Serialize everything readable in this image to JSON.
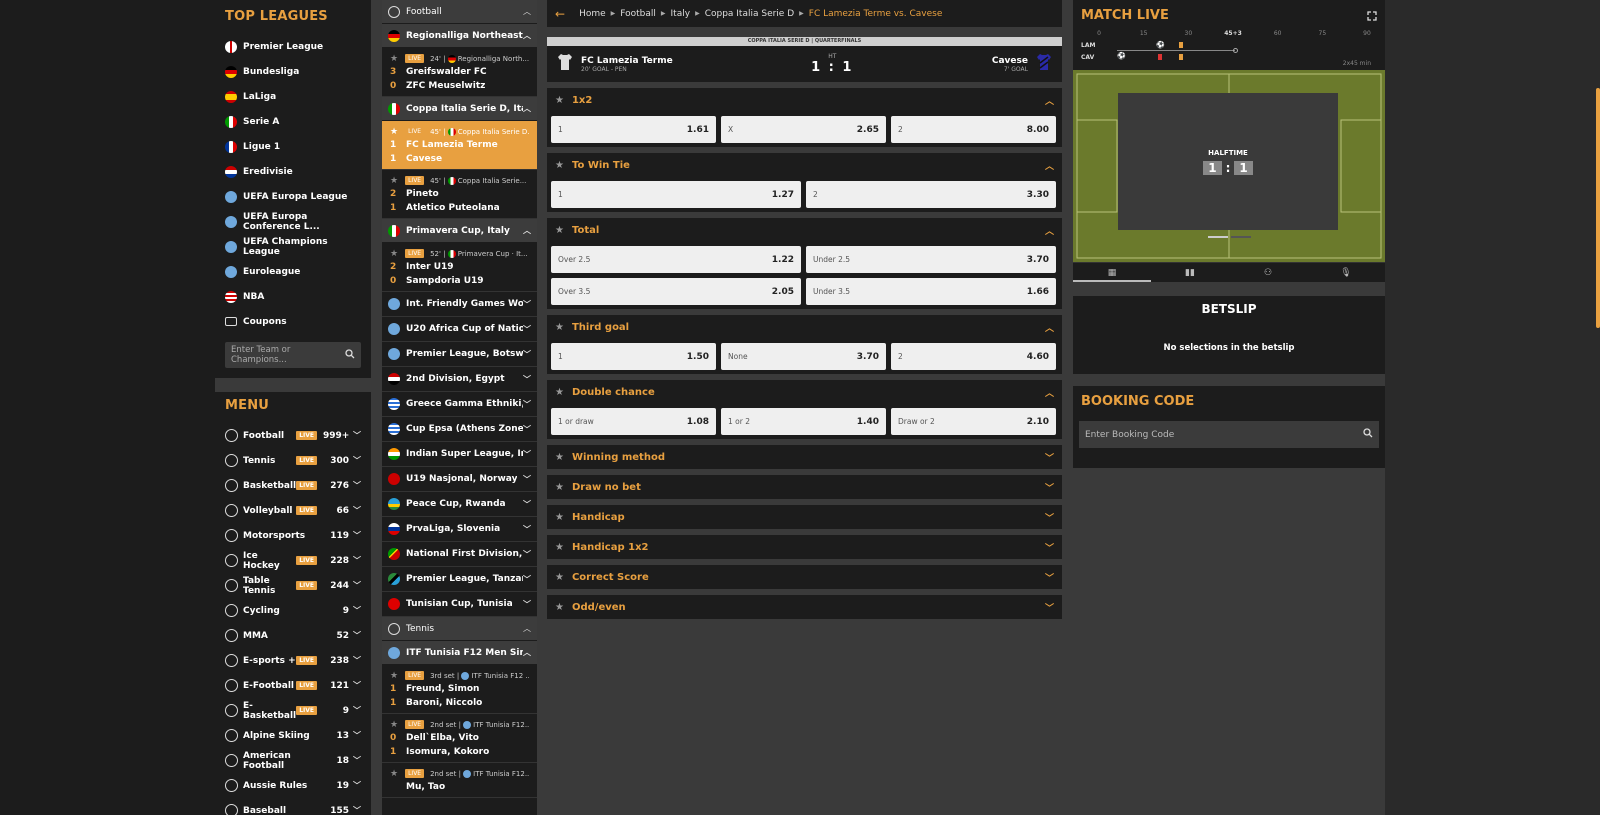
{
  "top_leagues": {
    "title": "TOP LEAGUES",
    "items": [
      {
        "label": "Premier League",
        "flag": "england"
      },
      {
        "label": "Bundesliga",
        "flag": "germany"
      },
      {
        "label": "LaLiga",
        "flag": "spain"
      },
      {
        "label": "Serie A",
        "flag": "italy"
      },
      {
        "label": "Ligue 1",
        "flag": "france"
      },
      {
        "label": "Eredivisie",
        "flag": "netherlands"
      },
      {
        "label": "UEFA Europa League",
        "flag": "world"
      },
      {
        "label": "UEFA Europa Conference L...",
        "flag": "world"
      },
      {
        "label": "UEFA Champions League",
        "flag": "world"
      },
      {
        "label": "Euroleague",
        "flag": "world"
      },
      {
        "label": "NBA",
        "flag": "usa"
      },
      {
        "label": "Coupons",
        "flag": "ticket"
      }
    ],
    "search_placeholder": "Enter Team or Champions..."
  },
  "menu": {
    "title": "MENU",
    "live_label": "LIVE",
    "items": [
      {
        "label": "Football",
        "live": true,
        "count": "999+",
        "icon": "football-icon"
      },
      {
        "label": "Tennis",
        "live": true,
        "count": "300",
        "icon": "tennis-icon"
      },
      {
        "label": "Basketball",
        "live": true,
        "count": "276",
        "icon": "basketball-icon"
      },
      {
        "label": "Volleyball",
        "live": true,
        "count": "66",
        "icon": "volleyball-icon"
      },
      {
        "label": "Motorsports",
        "live": false,
        "count": "119",
        "icon": "motorsports-icon"
      },
      {
        "label": "Ice Hockey",
        "live": true,
        "count": "228",
        "icon": "ice-hockey-icon"
      },
      {
        "label": "Table Tennis",
        "live": true,
        "count": "244",
        "icon": "table-tennis-icon"
      },
      {
        "label": "Cycling",
        "live": false,
        "count": "9",
        "icon": "cycling-icon"
      },
      {
        "label": "MMA",
        "live": false,
        "count": "52",
        "icon": "mma-icon"
      },
      {
        "label": "E-sports +",
        "live": true,
        "count": "238",
        "icon": "esports-icon"
      },
      {
        "label": "E-Football",
        "live": true,
        "count": "121",
        "icon": "efootball-icon"
      },
      {
        "label": "E-Basketball",
        "live": true,
        "count": "9",
        "icon": "ebasketball-icon"
      },
      {
        "label": "Alpine Skiing",
        "live": false,
        "count": "13",
        "icon": "skiing-icon"
      },
      {
        "label": "American Football",
        "live": false,
        "count": "18",
        "icon": "american-football-icon"
      },
      {
        "label": "Aussie Rules",
        "live": false,
        "count": "19",
        "icon": "aussie-rules-icon"
      },
      {
        "label": "Baseball",
        "live": false,
        "count": "155",
        "icon": "baseball-icon"
      }
    ]
  },
  "live_list": {
    "football_label": "Football",
    "tennis_label": "Tennis",
    "groups": {
      "regionalliga": {
        "title": "Regionalliga Northeast,...",
        "match": {
          "time": "24'",
          "comp": "Regionalliga North...",
          "home": "Greifswalder FC",
          "away": "ZFC Meuselwitz",
          "hs": "3",
          "as": "0"
        }
      },
      "coppa": {
        "title": "Coppa Italia Serie D, Italy",
        "match1": {
          "time": "45'",
          "comp": "Coppa Italia Serie D...",
          "home": "FC Lamezia Terme",
          "away": "Cavese",
          "hs": "1",
          "as": "1"
        },
        "match2": {
          "time": "45'",
          "comp": "Coppa Italia Serie...",
          "home": "Pineto",
          "away": "Atletico Puteolana",
          "hs": "2",
          "as": "1"
        }
      },
      "primavera": {
        "title": "Primavera Cup, Italy",
        "match": {
          "time": "52'",
          "comp": "Primavera Cup · It...",
          "home": "Inter U19",
          "away": "Sampdoria U19",
          "hs": "2",
          "as": "0"
        }
      },
      "collapsed": [
        "Int. Friendly Games Wo...",
        "U20 Africa Cup of Natio...",
        "Premier League, Botsw...",
        "2nd Division, Egypt",
        "Greece Gamma Ethniki, ...",
        "Cup Epsa (Athens Zone...",
        "Indian Super League, In...",
        "U19 Nasjonal, Norway",
        "Peace Cup, Rwanda",
        "PrvaLiga, Slovenia",
        "National First Division, ...",
        "Premier League, Tanzania",
        "Tunisian Cup, Tunisia"
      ],
      "itf": {
        "title": "ITF Tunisia F12 Men Sin...",
        "matches": [
          {
            "time": "3rd set",
            "comp": "ITF Tunisia F12 ...",
            "home": "Freund, Simon",
            "away": "Baroni, Niccolo",
            "hs": "1",
            "as": "1"
          },
          {
            "time": "2nd set",
            "comp": "ITF Tunisia F12...",
            "home": "Dell`Elba, Vito",
            "away": "Isomura, Kokoro",
            "hs": "0",
            "as": "1"
          },
          {
            "time": "2nd set",
            "comp": "ITF Tunisia F12...",
            "home": "Mu, Tao",
            "away": "",
            "hs": "",
            "as": ""
          }
        ]
      }
    }
  },
  "breadcrumb": {
    "items": [
      "Home",
      "Football",
      "Italy",
      "Coppa Italia Serie D"
    ],
    "current": "FC Lamezia Terme vs. Cavese"
  },
  "scoreboard": {
    "competition": "COPPA ITALIA SERIE D | QUARTERFINALS",
    "home": "FC Lamezia Terme",
    "home_sub": "20' GOAL - PEN",
    "away": "Cavese",
    "away_sub": "7' GOAL",
    "status": "HT",
    "score": "1 : 1"
  },
  "markets": [
    {
      "title": "1x2",
      "open": true,
      "layout": "w3",
      "odds": [
        {
          "l": "1",
          "v": "1.61"
        },
        {
          "l": "X",
          "v": "2.65"
        },
        {
          "l": "2",
          "v": "8.00"
        }
      ]
    },
    {
      "title": "To Win Tie",
      "open": true,
      "layout": "w2",
      "odds": [
        {
          "l": "1",
          "v": "1.27"
        },
        {
          "l": "2",
          "v": "3.30"
        }
      ]
    },
    {
      "title": "Total",
      "open": true,
      "layout": "w2",
      "odds": [
        {
          "l": "Over 2.5",
          "v": "1.22"
        },
        {
          "l": "Under 2.5",
          "v": "3.70"
        },
        {
          "l": "Over 3.5",
          "v": "2.05"
        },
        {
          "l": "Under 3.5",
          "v": "1.66"
        }
      ]
    },
    {
      "title": "Third goal",
      "open": true,
      "layout": "w3",
      "odds": [
        {
          "l": "1",
          "v": "1.50"
        },
        {
          "l": "None",
          "v": "3.70"
        },
        {
          "l": "2",
          "v": "4.60"
        }
      ]
    },
    {
      "title": "Double chance",
      "open": true,
      "layout": "w3",
      "odds": [
        {
          "l": "1 or draw",
          "v": "1.08"
        },
        {
          "l": "1 or 2",
          "v": "1.40"
        },
        {
          "l": "Draw or 2",
          "v": "2.10"
        }
      ]
    },
    {
      "title": "Winning method",
      "open": false
    },
    {
      "title": "Draw no bet",
      "open": false
    },
    {
      "title": "Handicap",
      "open": false
    },
    {
      "title": "Handicap 1x2",
      "open": false
    },
    {
      "title": "Correct Score",
      "open": false
    },
    {
      "title": "Odd/even",
      "open": false
    }
  ],
  "match_live": {
    "title": "MATCH LIVE",
    "timeline_ticks": [
      "0",
      "15",
      "30",
      "45+3",
      "60",
      "75",
      "90"
    ],
    "home_abbr": "LAM",
    "away_abbr": "CAV",
    "duration": "2x45 min",
    "halftime_label": "HALFTIME",
    "home_score": "1",
    "away_score": "1"
  },
  "betslip": {
    "title": "BETSLIP",
    "empty": "No selections in the betslip"
  },
  "booking": {
    "title": "BOOKING CODE",
    "placeholder": "Enter Booking Code"
  },
  "colors": {
    "accent": "#e8a040",
    "panel": "#1c1c1c",
    "background": "#3a3a3a"
  }
}
